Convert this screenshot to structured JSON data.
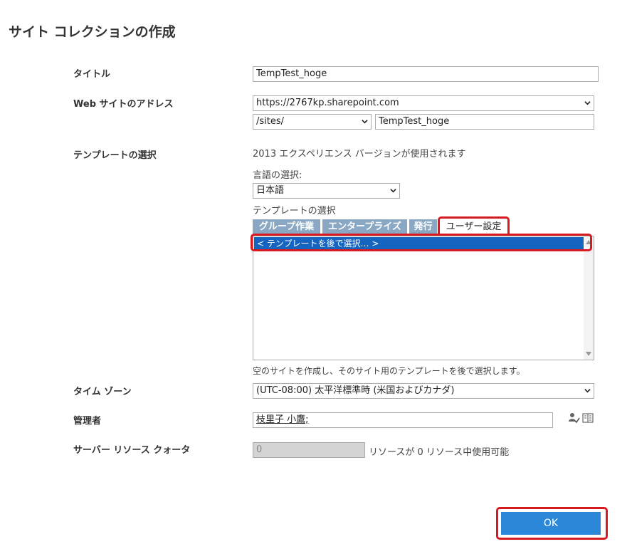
{
  "page": {
    "title": "サイト コレクションの作成"
  },
  "labels": {
    "title": "タイトル",
    "web_address": "Web サイトのアドレス",
    "template": "テンプレートの選択",
    "timezone": "タイム ゾーン",
    "admin": "管理者",
    "quota": "サーバー リソース クォータ"
  },
  "title_field": {
    "value": "TempTest_hoge"
  },
  "address": {
    "domain": "https://2767kp.sharepoint.com",
    "path": "/sites/",
    "name": "TempTest_hoge"
  },
  "template": {
    "version_text": "2013 エクスペリエンス バージョンが使用されます",
    "language_label": "言語の選択:",
    "language_value": "日本語",
    "template_label": "テンプレートの選択",
    "tabs": [
      "グループ作業",
      "エンタープライズ",
      "発行",
      "ユーザー設定"
    ],
    "active_tab": "ユーザー設定",
    "list_items": [
      "< テンプレートを後で選択… >"
    ],
    "description": "空のサイトを作成し、そのサイト用のテンプレートを後で選択します。"
  },
  "timezone": {
    "value": "(UTC-08:00) 太平洋標準時 (米国およびカナダ)"
  },
  "admin": {
    "value": "枝里子 小鷹;"
  },
  "quota": {
    "value": "0",
    "suffix": "リソースが 0 リソース中使用可能"
  },
  "buttons": {
    "ok": "OK"
  },
  "colors": {
    "accent": "#2b88d8",
    "highlight": "#d71920",
    "tab": "#8aa8c4",
    "selection": "#1565c0"
  },
  "icons": [
    "check-names-icon",
    "address-book-icon",
    "chevron-down-icon",
    "scroll-up-icon",
    "scroll-down-icon"
  ]
}
